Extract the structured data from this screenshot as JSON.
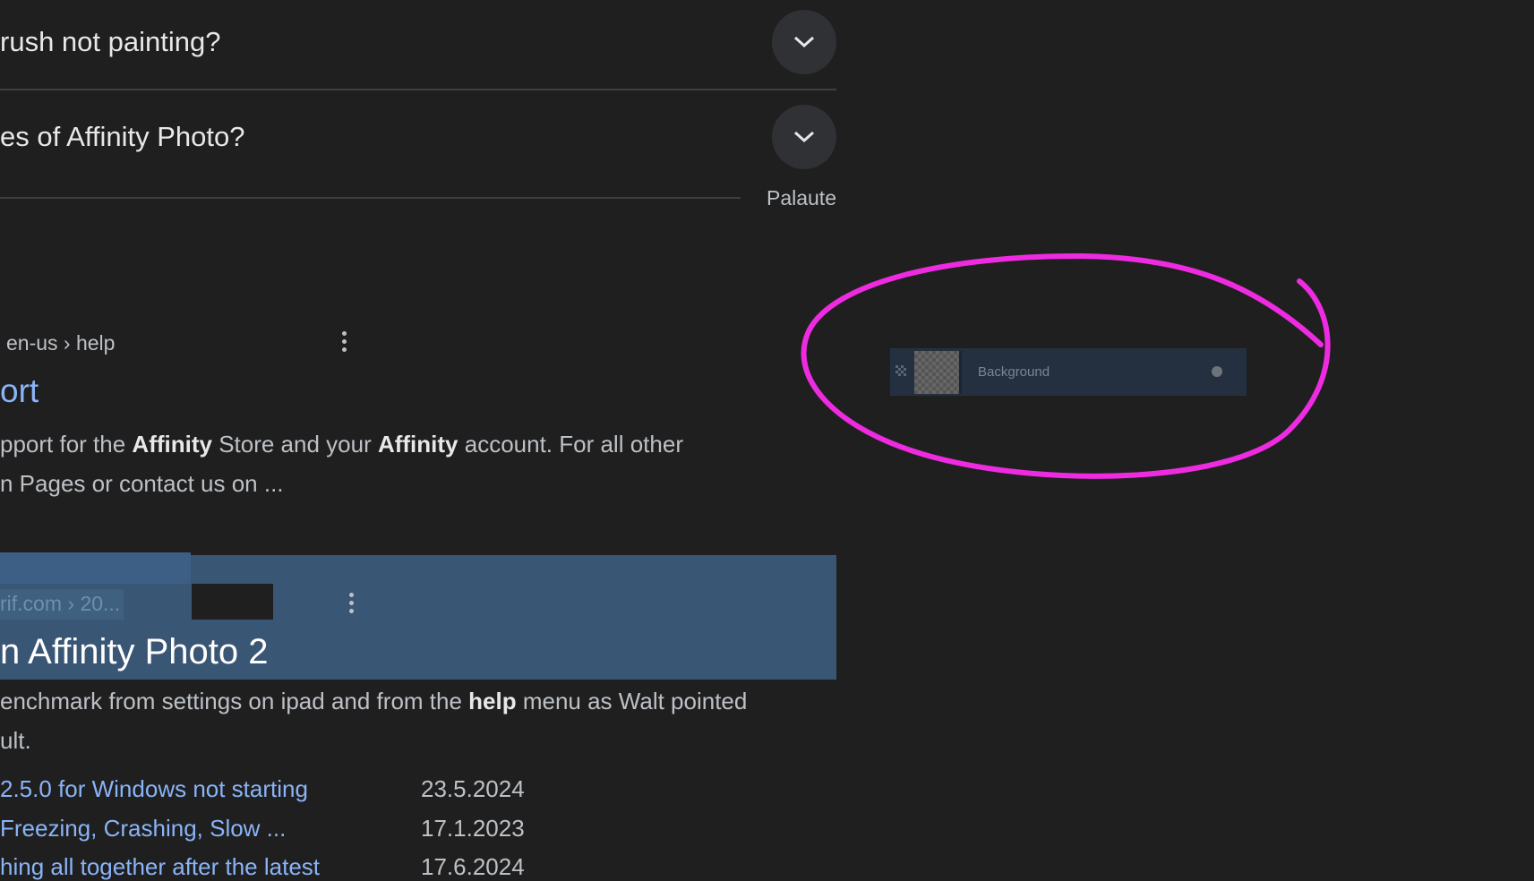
{
  "faq": [
    {
      "question": "rush not painting?"
    },
    {
      "question": "es of Affinity Photo?"
    }
  ],
  "feedback_label": "Palaute",
  "results": [
    {
      "breadcrumb": "en-us › help",
      "title": "ort",
      "snippet_html": "pport for the <b>Affinity</b> Store and your <b>Affinity</b> account. For all other<br>n Pages or contact us on ..."
    },
    {
      "breadcrumb": "rif.com › 20...",
      "title": "n Affinity Photo 2",
      "snippet_html": "enchmark from settings on ipad and from the <b>help</b> menu as Walt pointed<br>ult.",
      "sitelinks": [
        {
          "label": "2.5.0 for Windows not starting",
          "date": "23.5.2024"
        },
        {
          "label": " Freezing, Crashing, Slow ...",
          "date": "17.1.2023"
        },
        {
          "label": "hing all together after the latest",
          "date": "17.6.2024"
        }
      ]
    }
  ],
  "layer_panel": {
    "layer_name": "Background"
  },
  "colors": {
    "annotation": "#ee2be0",
    "link": "#8ab4f8",
    "highlight": "#3a5675"
  }
}
